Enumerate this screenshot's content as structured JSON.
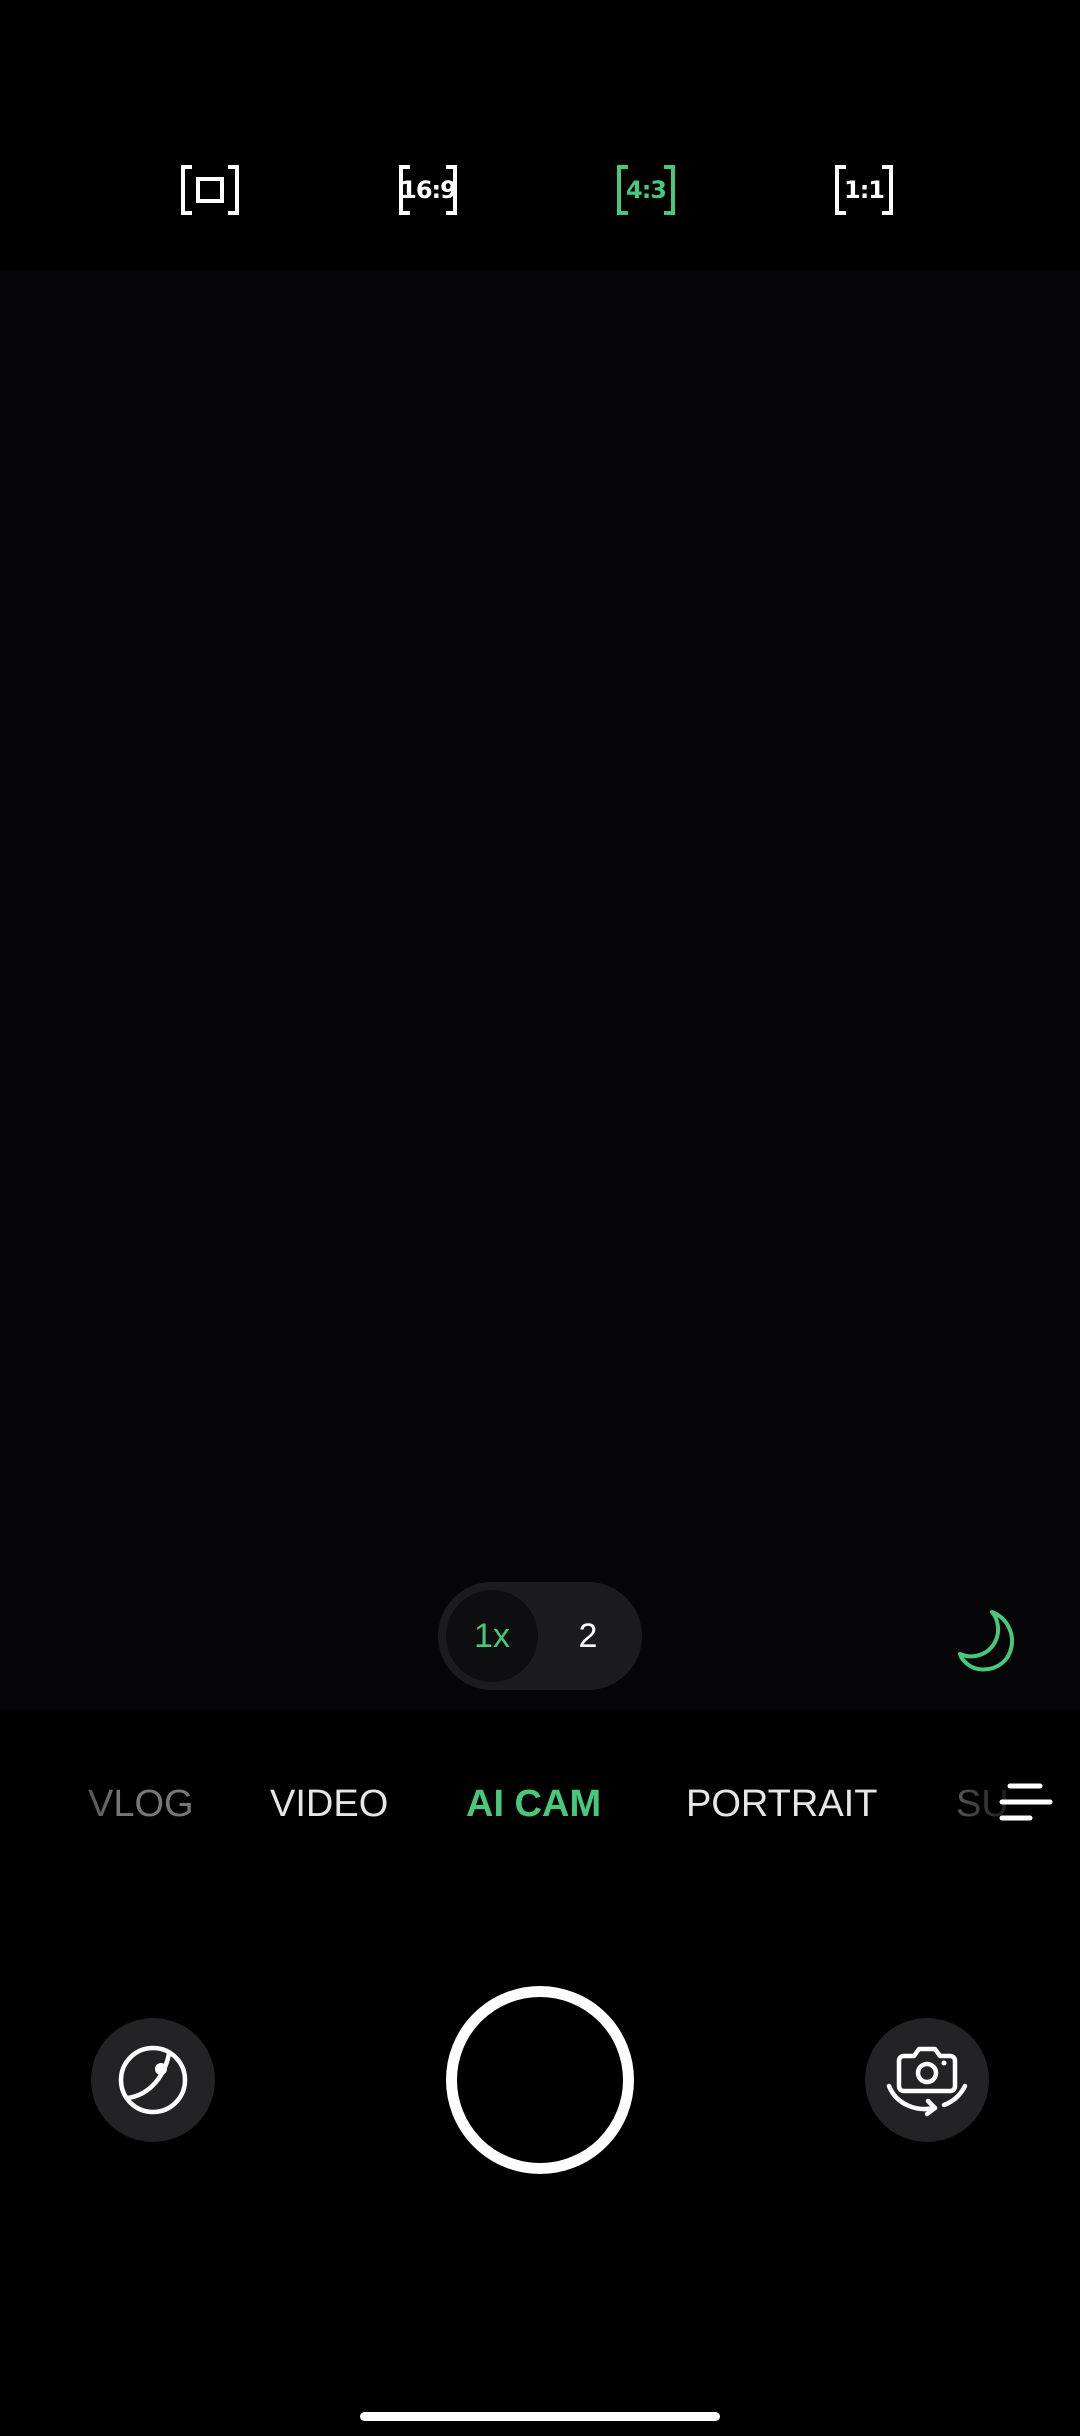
{
  "colors": {
    "accent": "#46c97b",
    "background": "#000000",
    "text": "#ffffff"
  },
  "aspect_ratios": [
    {
      "label": "",
      "icon": "full-frame-icon",
      "active": false
    },
    {
      "label": "16:9",
      "icon": "ratio-16-9-icon",
      "active": false
    },
    {
      "label": "4:3",
      "icon": "ratio-4-3-icon",
      "active": true
    },
    {
      "label": "1:1",
      "icon": "ratio-1-1-icon",
      "active": false
    }
  ],
  "zoom": {
    "options": [
      "1x",
      "2"
    ],
    "selected": "1x"
  },
  "night_mode": {
    "icon": "moon-icon"
  },
  "modes": {
    "items": [
      "VLOG",
      "VIDEO",
      "AI CAM",
      "PORTRAIT",
      "SU"
    ],
    "selected": "AI CAM"
  },
  "more_modes": {
    "icon": "menu-lines-icon"
  },
  "bottom": {
    "left_icon": "filter-icon",
    "right_icon": "switch-camera-icon"
  }
}
